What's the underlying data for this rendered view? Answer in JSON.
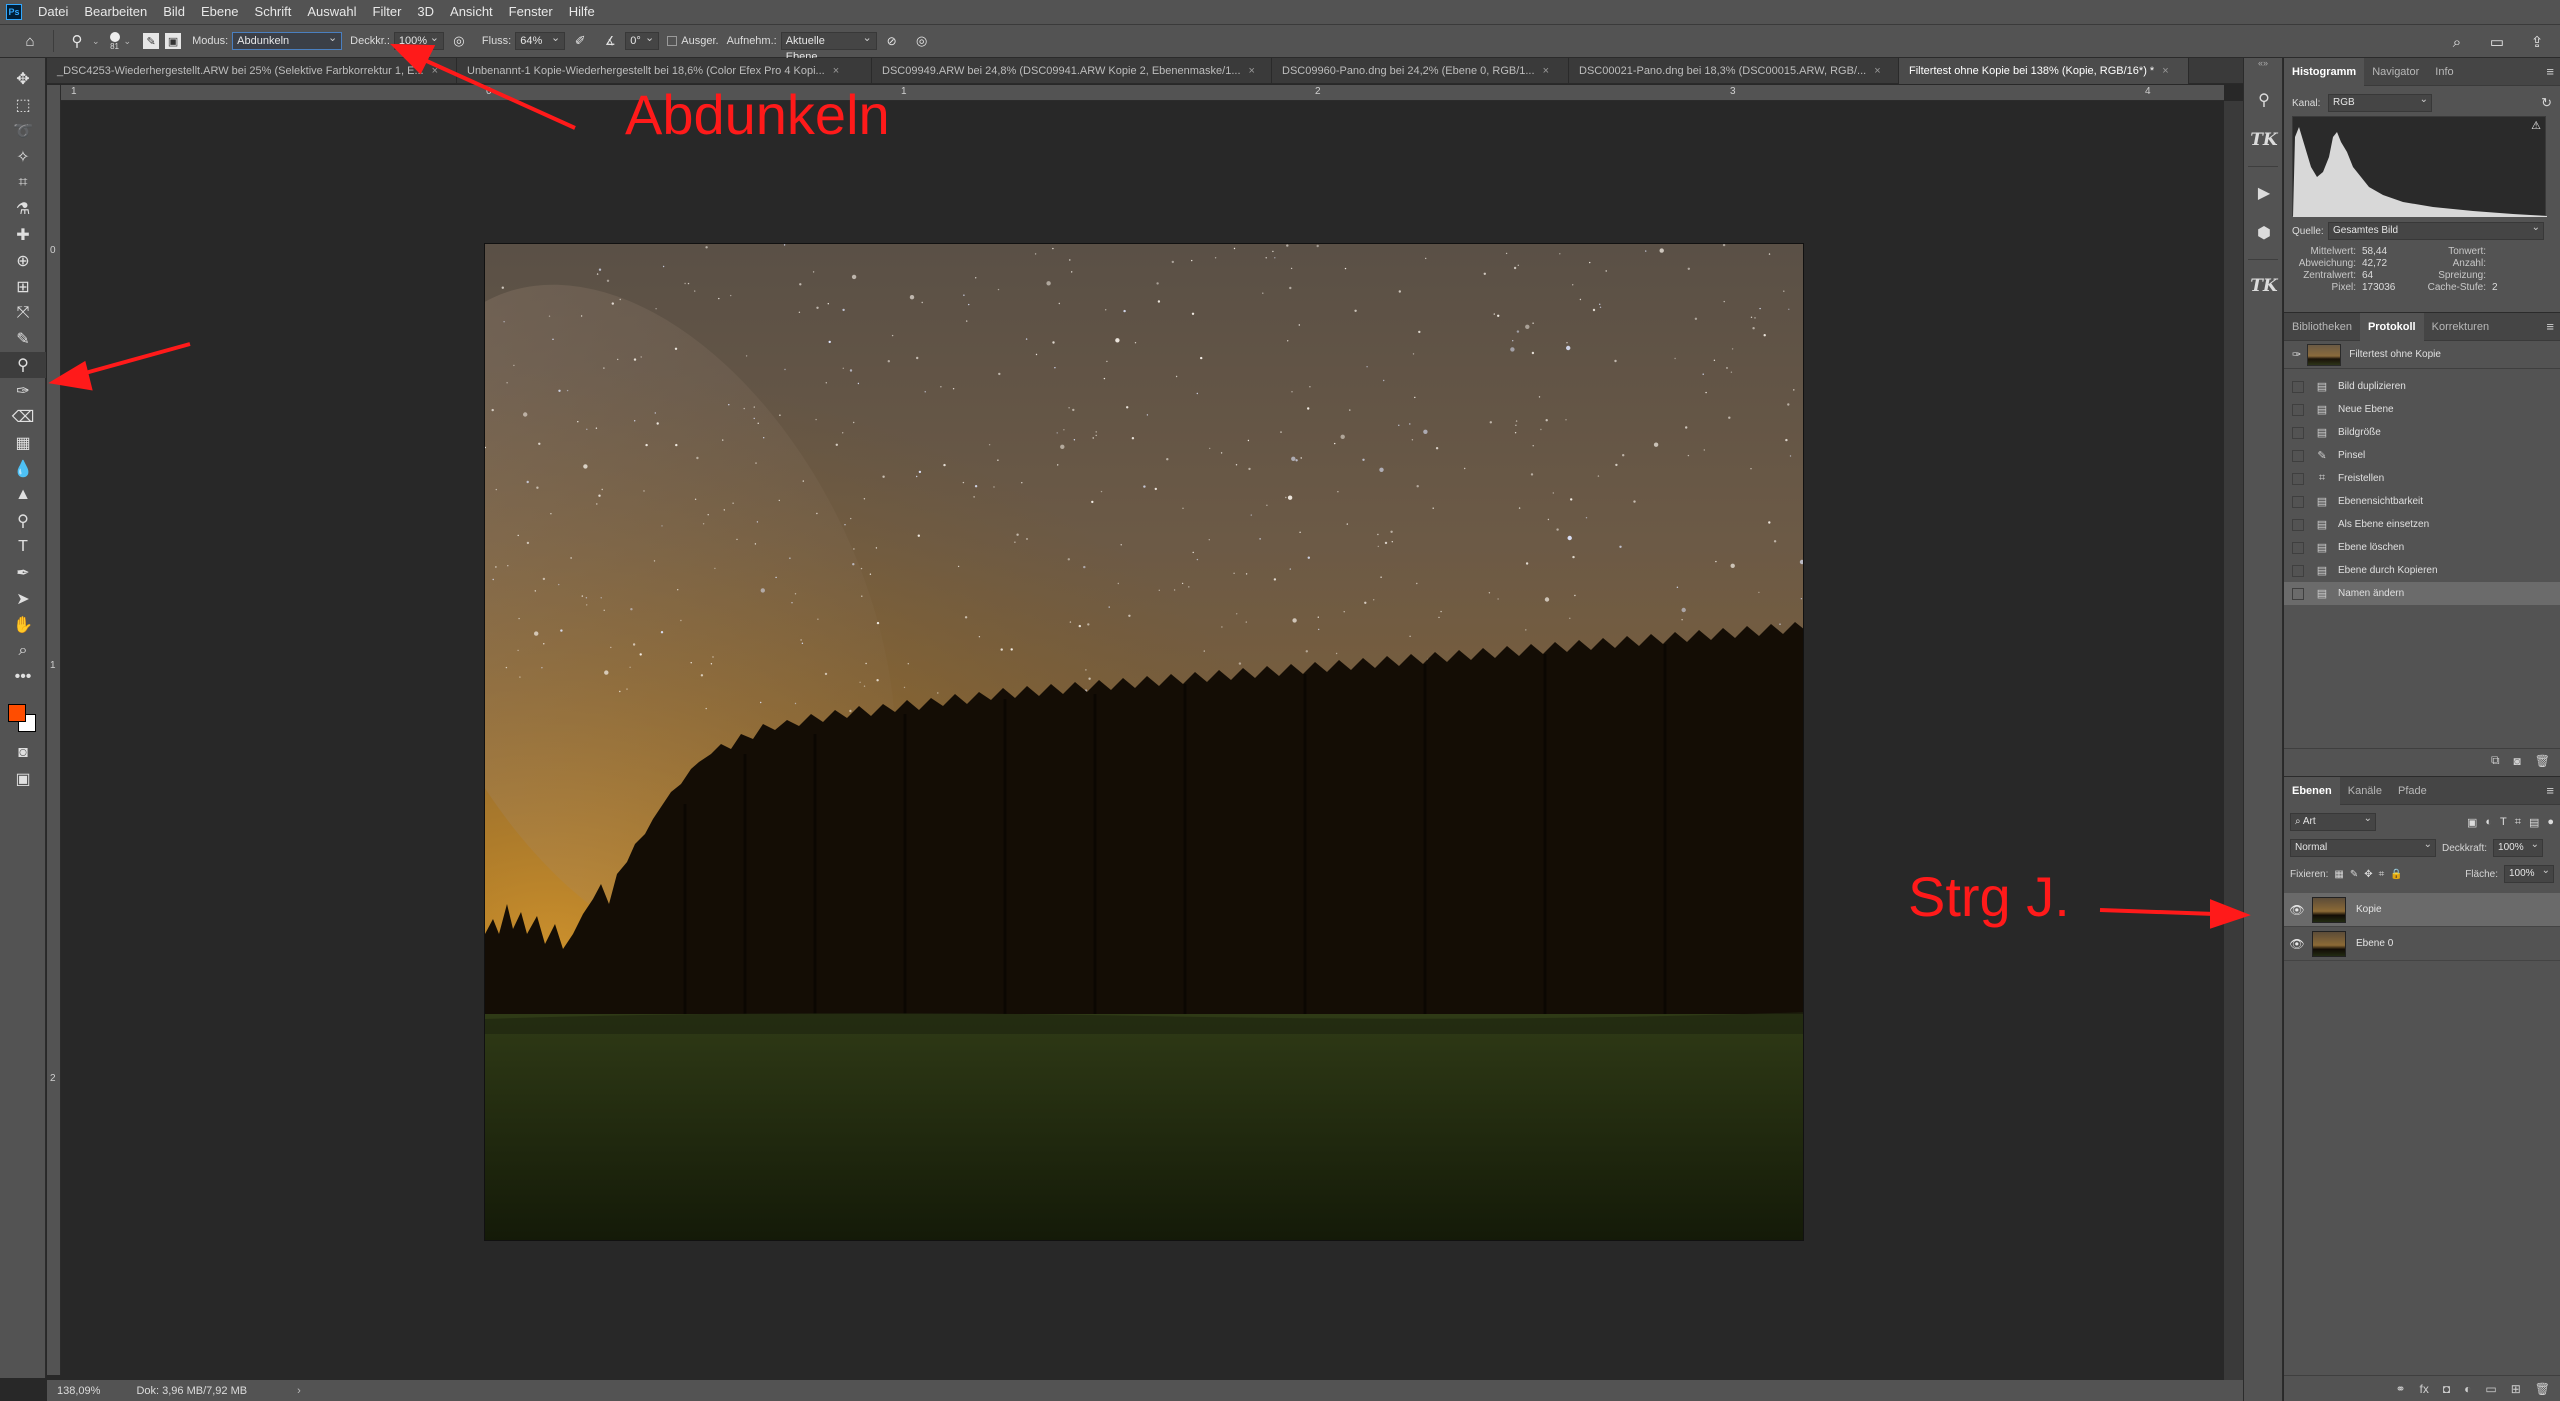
{
  "menubar": {
    "logo": "Ps",
    "items": [
      "Datei",
      "Bearbeiten",
      "Bild",
      "Ebene",
      "Schrift",
      "Auswahl",
      "Filter",
      "3D",
      "Ansicht",
      "Fenster",
      "Hilfe"
    ]
  },
  "options": {
    "brush_size": "81",
    "modus_label": "Modus:",
    "modus_value": "Abdunkeln",
    "deckkr_label": "Deckkr.:",
    "deckkr_value": "100%",
    "fluss_label": "Fluss:",
    "fluss_value": "64%",
    "angle_value": "0°",
    "ausger_label": "Ausger.",
    "aufnehm_label": "Aufnehm.:",
    "aufnehm_value": "Aktuelle Ebene"
  },
  "tabs": [
    {
      "label": "_DSC4253-Wiederhergestellt.ARW bei 25% (Selektive Farbkorrektur 1, E...",
      "active": false
    },
    {
      "label": "Unbenannt-1 Kopie-Wiederhergestellt bei 18,6% (Color Efex Pro 4 Kopi...",
      "active": false
    },
    {
      "label": "DSC09949.ARW bei 24,8% (DSC09941.ARW Kopie 2, Ebenenmaske/1...",
      "active": false
    },
    {
      "label": "DSC09960-Pano.dng bei 24,2% (Ebene 0, RGB/1...",
      "active": false
    },
    {
      "label": "DSC00021-Pano.dng bei 18,3% (DSC00015.ARW, RGB/...",
      "active": false
    },
    {
      "label": "Filtertest ohne Kopie bei 138% (Kopie, RGB/16*) *",
      "active": true
    }
  ],
  "ruler": {
    "top": [
      "1",
      "0",
      "1",
      "2",
      "3",
      "4"
    ],
    "left": [
      "0",
      "1",
      "2"
    ]
  },
  "status": {
    "zoom": "138,09%",
    "doc": "Dok: 3,96 MB/7,92 MB"
  },
  "histogram": {
    "tabs": [
      "Histogramm",
      "Navigator",
      "Info"
    ],
    "kanal_label": "Kanal:",
    "kanal_value": "RGB",
    "quelle_label": "Quelle:",
    "quelle_value": "Gesamtes Bild",
    "stats": [
      {
        "k": "Mittelwert:",
        "v": "58,44",
        "k2": "Tonwert:",
        "v2": ""
      },
      {
        "k": "Abweichung:",
        "v": "42,72",
        "k2": "Anzahl:",
        "v2": ""
      },
      {
        "k": "Zentralwert:",
        "v": "64",
        "k2": "Spreizung:",
        "v2": ""
      },
      {
        "k": "Pixel:",
        "v": "173036",
        "k2": "Cache-Stufe:",
        "v2": "2"
      }
    ]
  },
  "protokoll": {
    "tabs": [
      "Bibliotheken",
      "Protokoll",
      "Korrekturen"
    ],
    "snapshot": "Filtertest ohne Kopie",
    "items": [
      {
        "label": "Bild duplizieren",
        "icon": "▤"
      },
      {
        "label": "Neue Ebene",
        "icon": "▤"
      },
      {
        "label": "Bildgröße",
        "icon": "▤"
      },
      {
        "label": "Pinsel",
        "icon": "✎"
      },
      {
        "label": "Freistellen",
        "icon": "⌗"
      },
      {
        "label": "Ebenensichtbarkeit",
        "icon": "▤"
      },
      {
        "label": "Als Ebene einsetzen",
        "icon": "▤"
      },
      {
        "label": "Ebene löschen",
        "icon": "▤"
      },
      {
        "label": "Ebene durch Kopieren",
        "icon": "▤"
      },
      {
        "label": "Namen ändern",
        "icon": "▤"
      }
    ]
  },
  "ebenen": {
    "tabs": [
      "Ebenen",
      "Kanäle",
      "Pfade"
    ],
    "filter_value": "Art",
    "blend_value": "Normal",
    "deckkraft_label": "Deckkraft:",
    "deckkraft_value": "100%",
    "fixieren_label": "Fixieren:",
    "flaeche_label": "Fläche:",
    "flaeche_value": "100%",
    "layers": [
      {
        "name": "Kopie",
        "selected": true
      },
      {
        "name": "Ebene 0",
        "selected": false
      }
    ]
  },
  "annotations": {
    "abdunkeln": "Abdunkeln",
    "strg": "Strg J."
  },
  "colors": {
    "foreground": "#ff4d00",
    "background": "#ffffff",
    "annotation": "#ff1a1a"
  }
}
